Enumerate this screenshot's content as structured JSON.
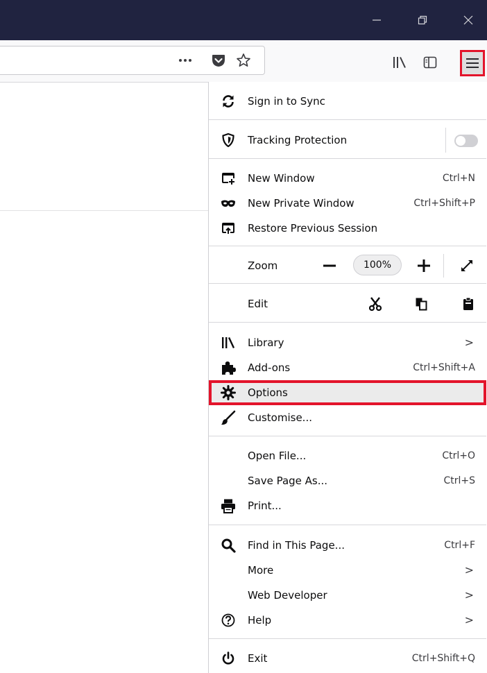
{
  "window": {
    "minimize_icon": "minimize-icon",
    "restore_icon": "restore-icon",
    "close_icon": "close-icon"
  },
  "toolbar": {
    "page_actions_icon": "more-dots-icon",
    "pocket_icon": "pocket-icon",
    "bookmark_icon": "star-icon",
    "library_icon": "library-icon",
    "sidebar_icon": "sidebar-icon",
    "menu_icon": "hamburger-icon"
  },
  "menu": {
    "sign_in": "Sign in to Sync",
    "tracking": "Tracking Protection",
    "new_window": {
      "label": "New Window",
      "shortcut": "Ctrl+N"
    },
    "new_private": {
      "label": "New Private Window",
      "shortcut": "Ctrl+Shift+P"
    },
    "restore_session": "Restore Previous Session",
    "zoom": {
      "label": "Zoom",
      "value": "100%"
    },
    "edit": "Edit",
    "library": "Library",
    "addons": {
      "label": "Add-ons",
      "shortcut": "Ctrl+Shift+A"
    },
    "options": "Options",
    "customise": "Customise...",
    "open_file": {
      "label": "Open File...",
      "shortcut": "Ctrl+O"
    },
    "save_page": {
      "label": "Save Page As...",
      "shortcut": "Ctrl+S"
    },
    "print": "Print...",
    "find": {
      "label": "Find in This Page...",
      "shortcut": "Ctrl+F"
    },
    "more": "More",
    "web_developer": "Web Developer",
    "help": "Help",
    "exit": {
      "label": "Exit",
      "shortcut": "Ctrl+Shift+Q"
    },
    "arrow": ">",
    "highlight_color": "#e3142b"
  }
}
